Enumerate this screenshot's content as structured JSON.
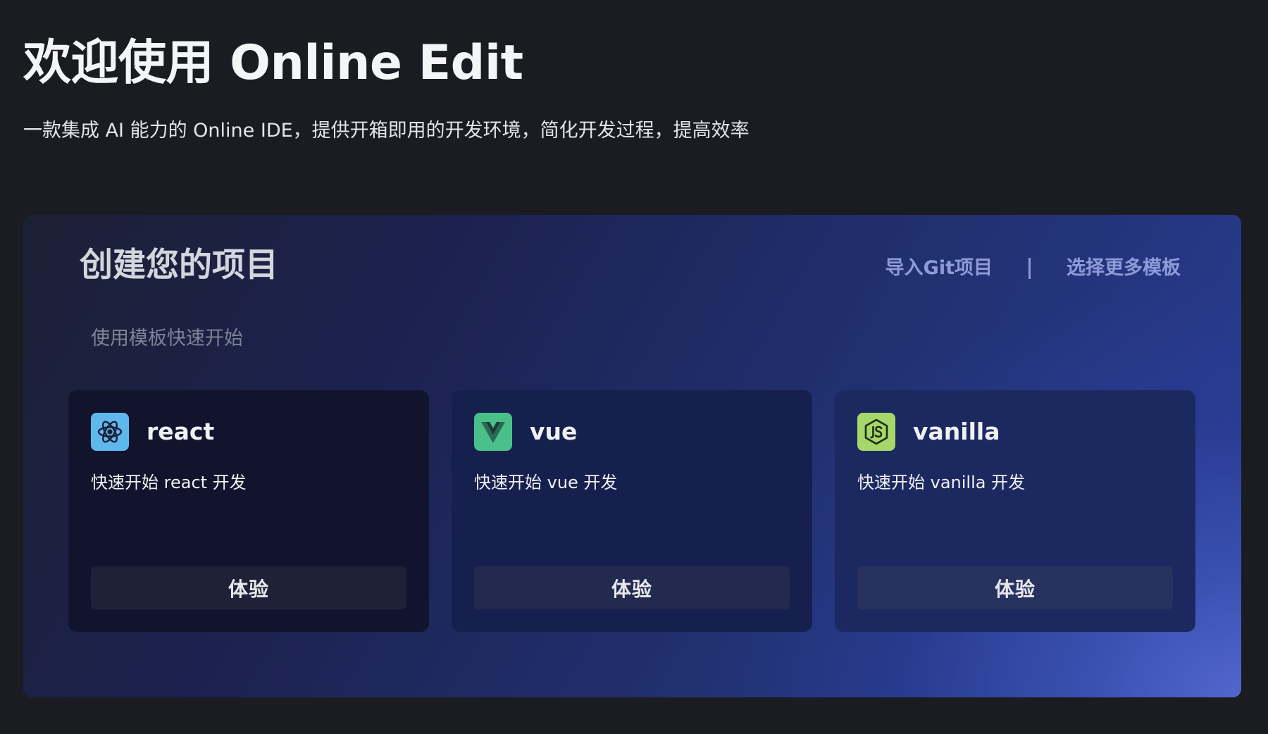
{
  "header": {
    "title": "欢迎使用 Online Edit",
    "subtitle": "一款集成 AI 能力的 Online IDE，提供开箱即用的开发环境，简化开发过程，提高效率"
  },
  "panel": {
    "title": "创建您的项目",
    "import_git_label": "导入Git项目",
    "more_templates_label": "选择更多模板",
    "section_label": "使用模板快速开始"
  },
  "templates": [
    {
      "name": "react",
      "description": "快速开始 react 开发",
      "button_label": "体验",
      "icon": "react-icon",
      "icon_color": "#5fb8ec"
    },
    {
      "name": "vue",
      "description": "快速开始 vue 开发",
      "button_label": "体验",
      "icon": "vue-icon",
      "icon_color": "#49c089"
    },
    {
      "name": "vanilla",
      "description": "快速开始 vanilla 开发",
      "button_label": "体验",
      "icon": "nodejs-icon",
      "icon_color": "#a6d869"
    }
  ],
  "colors": {
    "page_background": "#1b1c21",
    "link": "#8f9bd9",
    "panel_accent": "#4f63c8"
  }
}
